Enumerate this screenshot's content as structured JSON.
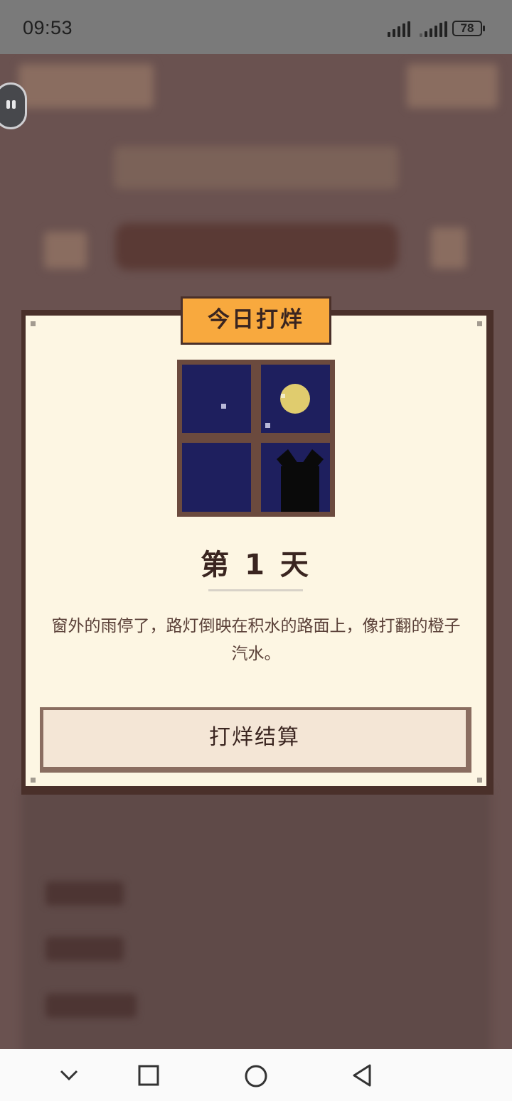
{
  "status_bar": {
    "time": "09:53",
    "battery": "78"
  },
  "modal": {
    "badge": "今日打烊",
    "day_title": "第 1 天",
    "story": "窗外的雨停了，路灯倒映在积水的路面上，像打翻的橙子汽水。",
    "settle_button": "打烊结算"
  },
  "icons": {
    "nav_collapse": "chevron-down-icon",
    "nav_recents": "square-icon",
    "nav_home": "circle-icon",
    "nav_back": "triangle-back-icon"
  },
  "colors": {
    "badge": "#f8a93e",
    "modal_bg": "#fdf6e3",
    "frame": "#4a302a",
    "night_sky": "#1e1f5e",
    "moon": "#e0cc6e",
    "button_bg": "#f4e6d6"
  }
}
